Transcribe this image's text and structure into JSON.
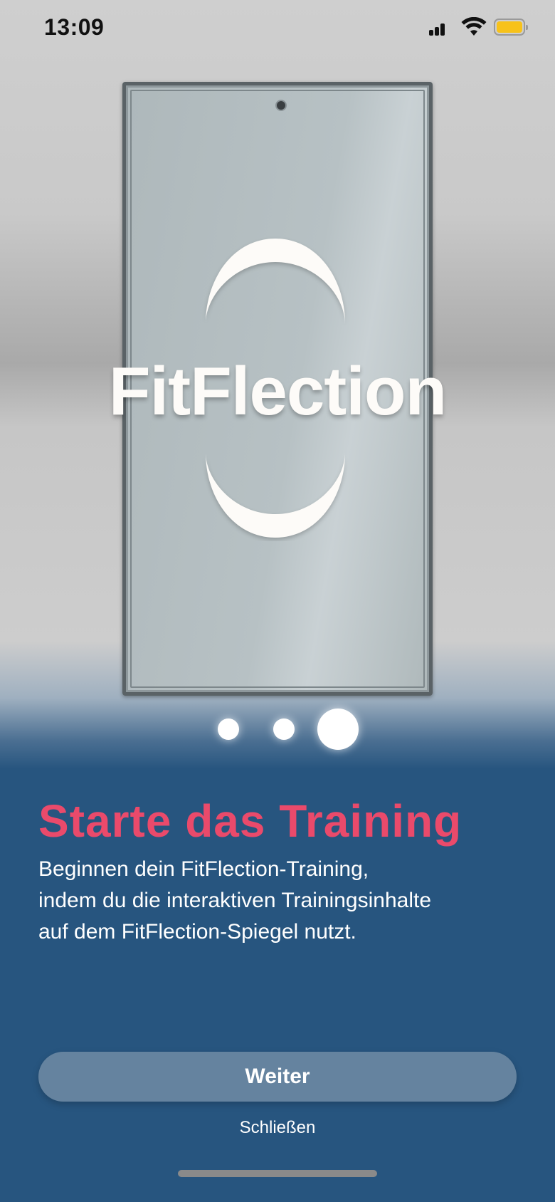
{
  "status_bar": {
    "time": "13:09",
    "battery_color": "#f7c21a",
    "icons": [
      "signal-icon",
      "wifi-icon",
      "battery-icon"
    ]
  },
  "hero": {
    "logo_text": "FitFlection",
    "logo_color": "#fdfbf8"
  },
  "pager": {
    "total_pages": 3,
    "active_page": 3
  },
  "content": {
    "headline": "Starte das Training",
    "description_lines": [
      "Beginnen dein FitFlection-Training,",
      "indem du die interaktiven Trainingsinhalte",
      "auf dem FitFlection-Spiegel nutzt."
    ]
  },
  "actions": {
    "primary_label": "Weiter",
    "secondary_label": "Schließen"
  },
  "colors": {
    "background": "#27557f",
    "accent": "#ea4a6b",
    "button": "#65839f"
  }
}
